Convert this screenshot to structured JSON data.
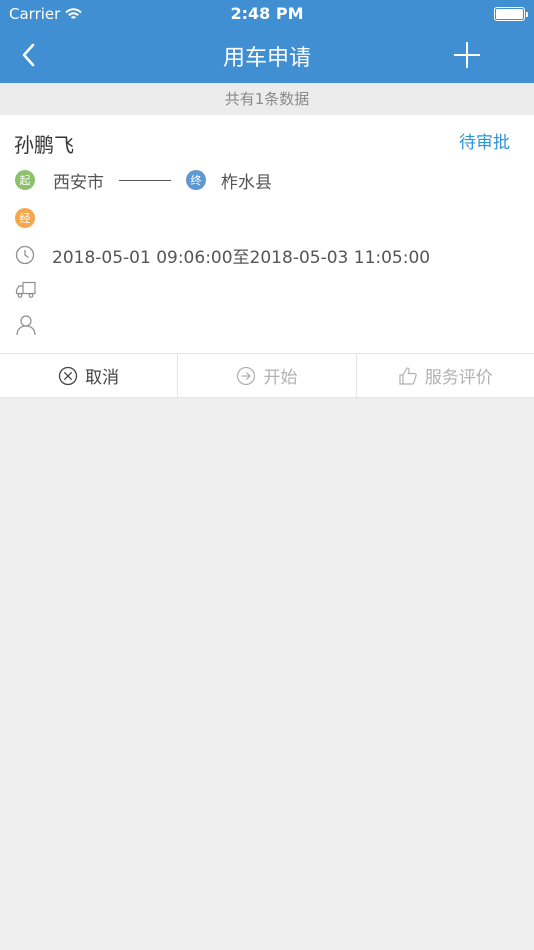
{
  "status_bar": {
    "carrier": "Carrier",
    "time": "2:48 PM"
  },
  "nav": {
    "title": "用车申请",
    "back_icon": "chevron-left-icon",
    "add_icon": "plus-icon"
  },
  "summary": {
    "count_text": "共有1条数据"
  },
  "request": {
    "applicant": "孙鹏飞",
    "status": "待审批",
    "start_badge": "起",
    "start_city": "西安市",
    "end_badge": "终",
    "end_city": "柞水县",
    "via_badge": "经",
    "via": "",
    "time_range": "2018-05-01 09:06:00至2018-05-03 11:05:00",
    "vehicle": "",
    "driver": ""
  },
  "actions": {
    "cancel": "取消",
    "start": "开始",
    "rate": "服务评价"
  },
  "colors": {
    "header": "#3f8fd2",
    "status": "#2f93d8",
    "start_badge": "#8cc06b",
    "end_badge": "#5f97d1",
    "via_badge": "#f6a64d"
  }
}
